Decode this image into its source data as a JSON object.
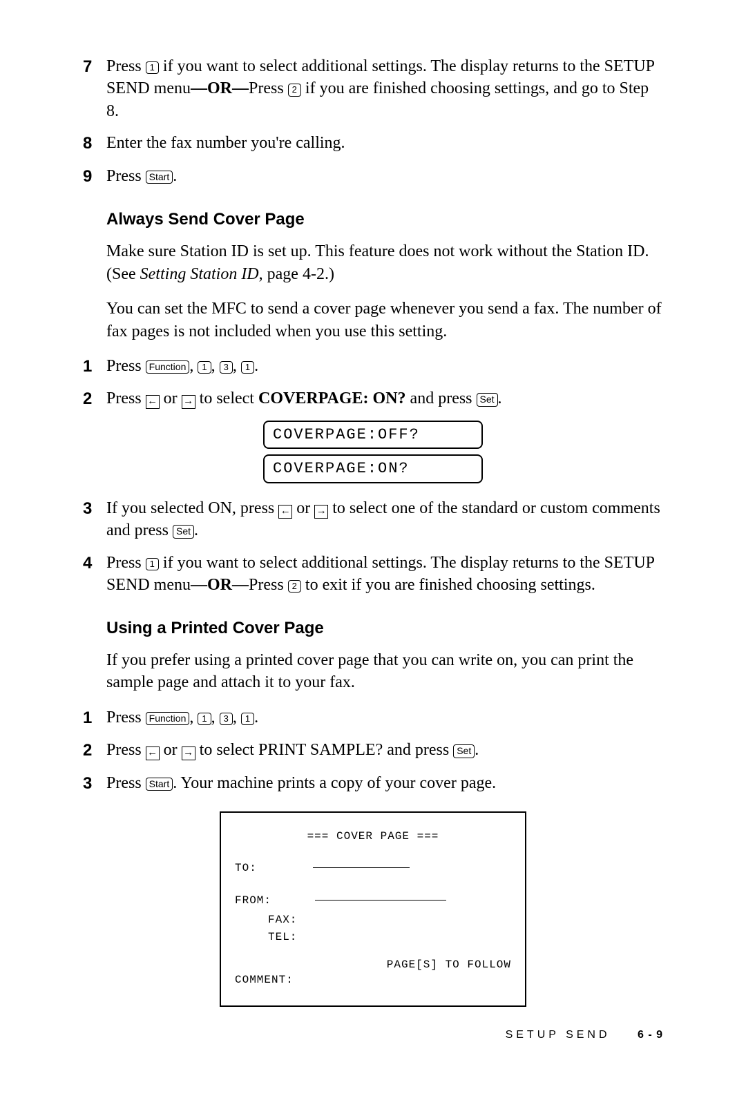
{
  "steps_top": {
    "s7": {
      "num": "7",
      "text_a": "Press ",
      "key1": "1",
      "text_b": " if you want to select additional settings. The display returns to the SETUP SEND menu",
      "or": "—OR—",
      "text_c": "Press ",
      "key2": "2",
      "text_d": " if you are finished choosing settings, and go to Step 8."
    },
    "s8": {
      "num": "8",
      "text": "Enter the fax number you're calling."
    },
    "s9": {
      "num": "9",
      "text_a": "Press ",
      "key": "Start",
      "text_b": "."
    }
  },
  "section1": {
    "heading": "Always Send Cover Page",
    "para1_a": "Make sure Station ID is set up. This feature does not work without the Station ID. (See ",
    "para1_ref": "Setting Station ID",
    "para1_b": ", page 4-2.)",
    "para2": "You can set the MFC to send a cover page whenever you send a fax. The number of fax pages is not included when you use this setting.",
    "s1": {
      "num": "1",
      "text_a": "Press ",
      "keyF": "Function",
      "k1": "1",
      "k3": "3",
      "k1b": "1",
      "text_end": "."
    },
    "s2": {
      "num": "2",
      "text_a": "Press ",
      "text_b": " or ",
      "text_c": " to select ",
      "bold": "COVERPAGE: ON?",
      "text_d": " and press ",
      "keySet": "Set",
      "text_e": "."
    },
    "lcd1": "COVERPAGE:OFF?",
    "lcd2": "COVERPAGE:ON?",
    "s3": {
      "num": "3",
      "text_a": "If you selected ON, press ",
      "text_b": " or ",
      "text_c": " to select one of the standard or custom comments and press ",
      "keySet": "Set",
      "text_d": "."
    },
    "s4": {
      "num": "4",
      "text_a": "Press ",
      "k1": "1",
      "text_b": " if you want to select additional settings. The display returns to the SETUP SEND menu",
      "or": "—OR—",
      "text_c": "Press ",
      "k2": "2",
      "text_d": " to exit if you are finished choosing settings."
    }
  },
  "section2": {
    "heading": "Using a Printed Cover Page",
    "para1": "If you prefer using a printed cover page that you can write on, you can print the sample page and attach it to your fax.",
    "s1": {
      "num": "1",
      "text_a": "Press ",
      "keyF": "Function",
      "k1": "1",
      "k3": "3",
      "k1b": "1",
      "text_end": "."
    },
    "s2": {
      "num": "2",
      "text_a": "Press ",
      "text_b": " or ",
      "text_c": " to select PRINT SAMPLE? and press ",
      "keySet": "Set",
      "text_d": "."
    },
    "s3": {
      "num": "3",
      "text_a": "Press ",
      "keyStart": "Start",
      "text_b": ". Your machine prints a copy of your cover page."
    }
  },
  "sample": {
    "title": "=== COVER PAGE ===",
    "to": "TO:",
    "from": "FROM:",
    "fax": "FAX:",
    "tel": "TEL:",
    "pages": "PAGE[S] TO FOLLOW",
    "comment": "COMMENT:"
  },
  "footer": {
    "label": "SETUP SEND",
    "page": "6 - 9"
  },
  "arrows": {
    "left": "←",
    "right": "→"
  }
}
